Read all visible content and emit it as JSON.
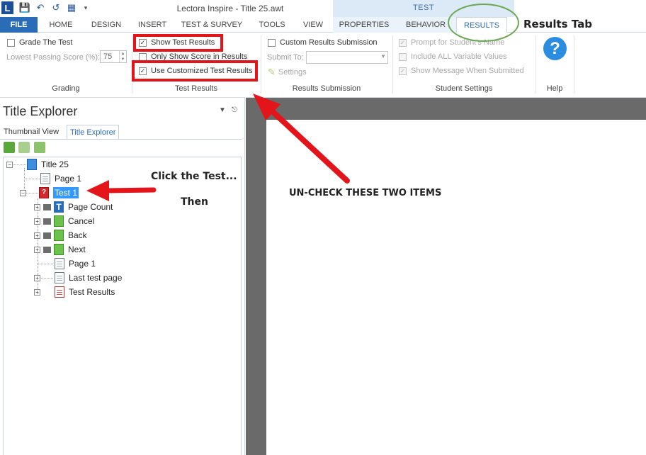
{
  "app": {
    "window_title": "Lectora Inspire - Title 25.awt",
    "logo_letter": "L",
    "context_group": "TEST"
  },
  "ribbon_tabs": [
    {
      "label": "FILE"
    },
    {
      "label": "HOME"
    },
    {
      "label": "DESIGN"
    },
    {
      "label": "INSERT"
    },
    {
      "label": "TEST & SURVEY"
    },
    {
      "label": "TOOLS"
    },
    {
      "label": "VIEW"
    },
    {
      "label": "PROPERTIES"
    },
    {
      "label": "BEHAVIOR"
    },
    {
      "label": "RESULTS"
    }
  ],
  "ribbon": {
    "grading": {
      "label": "Grading",
      "grade_the_test": {
        "label": "Grade The Test",
        "checked": false
      },
      "lowest_passing_label": "Lowest Passing Score (%):",
      "lowest_passing_value": "75"
    },
    "test_results": {
      "label": "Test Results",
      "show_test_results": {
        "label": "Show Test Results",
        "checked": true
      },
      "only_show_score": {
        "label": "Only Show Score in Results",
        "checked": false
      },
      "use_customized": {
        "label": "Use Customized Test Results",
        "checked": true
      }
    },
    "results_submission": {
      "label": "Results Submission",
      "custom_submission": {
        "label": "Custom Results Submission",
        "checked": false
      },
      "submit_to_label": "Submit To:",
      "settings_label": "Settings"
    },
    "student_settings": {
      "label": "Student Settings",
      "prompt_name": {
        "label": "Prompt for Student's Name",
        "checked": true
      },
      "include_variables": {
        "label": "Include ALL Variable Values",
        "checked": false
      },
      "show_message": {
        "label": "Show Message When Submitted",
        "checked": true
      }
    },
    "help": {
      "label": "Help",
      "glyph": "?"
    }
  },
  "panel": {
    "title": "Title Explorer",
    "tabs": [
      "Thumbnail View",
      "Title Explorer"
    ],
    "active_tab": "Title Explorer"
  },
  "tree": [
    {
      "label": "Title 25",
      "icon": "book-icon"
    },
    {
      "label": "Page 1",
      "icon": "page-icon"
    },
    {
      "label": "Test 1",
      "icon": "test-icon",
      "selected": true
    },
    {
      "label": "Page Count",
      "icon": "text-icon"
    },
    {
      "label": "Cancel",
      "icon": "button-icon"
    },
    {
      "label": "Back",
      "icon": "button-icon"
    },
    {
      "label": "Next",
      "icon": "button-icon"
    },
    {
      "label": "Page 1",
      "icon": "page-icon"
    },
    {
      "label": "Last test page",
      "icon": "page-icon"
    },
    {
      "label": "Test Results",
      "icon": "results-icon"
    }
  ],
  "annotations": {
    "results_tab": "Results Tab",
    "click_test": "Click the Test...",
    "then": "Then",
    "uncheck": "UN-CHECK THESE TWO ITEMS"
  },
  "colors": {
    "accent_blue": "#2b6cb8",
    "highlight_red": "#e4141b",
    "annotation_green": "#6aa84f",
    "selection_blue": "#3399ff"
  }
}
